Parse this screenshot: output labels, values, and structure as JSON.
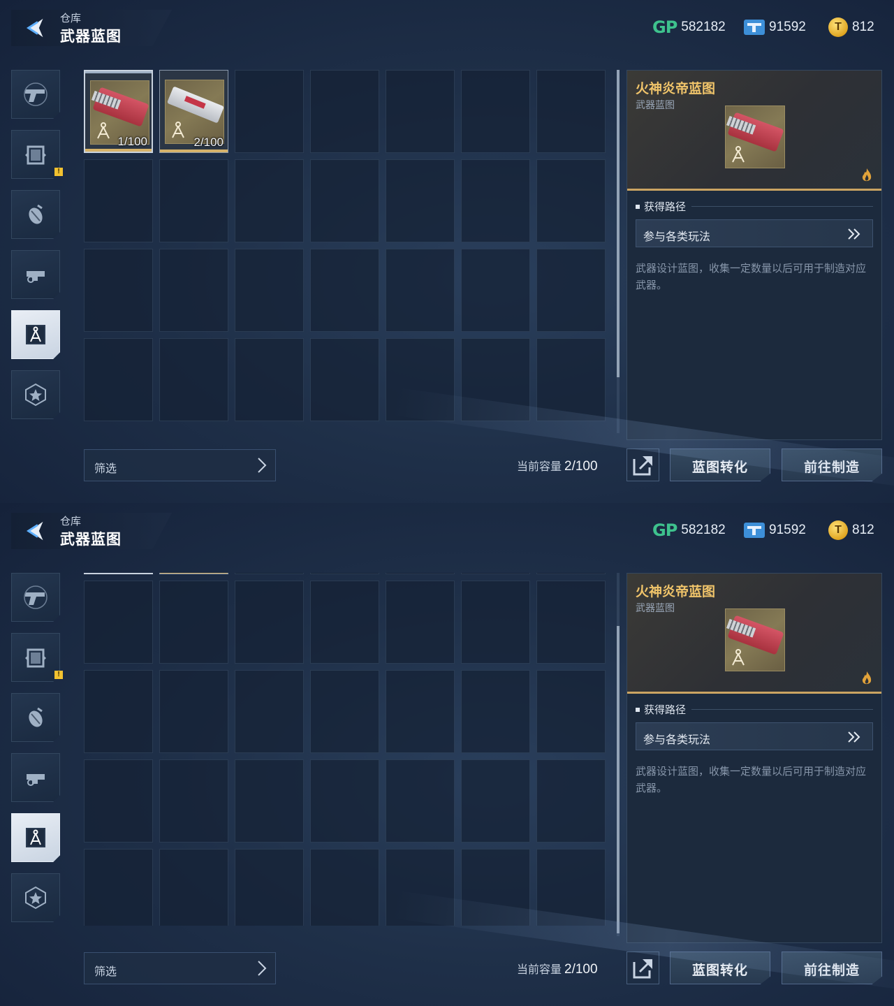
{
  "header": {
    "crumb": "仓库",
    "title": "武器蓝图",
    "currencies": [
      {
        "icon": "gp-icon",
        "value": "582182"
      },
      {
        "icon": "ticket-icon",
        "value": "91592"
      },
      {
        "icon": "coin-icon",
        "value": "812"
      }
    ]
  },
  "categories": [
    {
      "icon": "pistol-icon",
      "active": false,
      "alert": false
    },
    {
      "icon": "armor-icon",
      "active": false,
      "alert": false
    },
    {
      "icon": "grenade-icon",
      "active": false,
      "alert": true
    },
    {
      "icon": "attachment-icon",
      "active": false,
      "alert": false
    },
    {
      "icon": "blueprint-icon",
      "active": true,
      "alert": false
    },
    {
      "icon": "star-badge-icon",
      "active": false,
      "alert": false
    }
  ],
  "alert_mark": "!",
  "items": [
    {
      "count": "1/100",
      "art": "red-minigun",
      "selected": true
    },
    {
      "count": "2/100",
      "art": "white-rifle",
      "selected": false
    }
  ],
  "filter": {
    "label": "筛选"
  },
  "capacity": {
    "label": "当前容量",
    "value": "2/100"
  },
  "detail": {
    "name": "火神炎帝蓝图",
    "type": "武器蓝图",
    "section_title": "获得路径",
    "route_label": "参与各类玩法",
    "description": "武器设计蓝图，收集一定数量以后可用于制造对应武器。"
  },
  "actions": {
    "convert": "蓝图转化",
    "craft": "前往制造"
  },
  "panels": [
    {
      "scroll_fraction": 0.0
    },
    {
      "scroll_fraction": 0.95
    }
  ],
  "colors": {
    "accent_gold": "#f0c46a",
    "gp_green": "#3ec28d",
    "ticket_blue": "#3d8fd8"
  }
}
